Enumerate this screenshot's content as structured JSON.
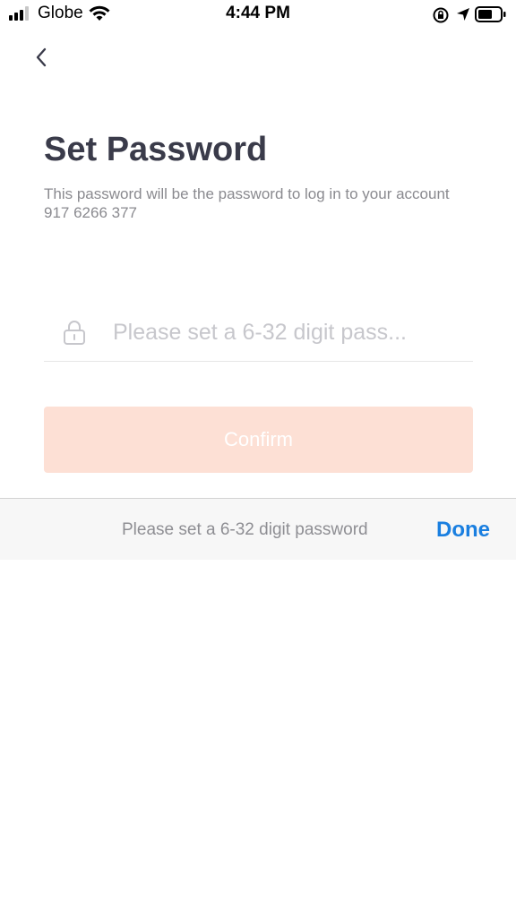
{
  "status_bar": {
    "carrier": "Globe",
    "time": "4:44 PM"
  },
  "screen": {
    "title": "Set Password",
    "subtitle": "This password will be the password to log in to your account 917 6266 377"
  },
  "password_field": {
    "placeholder": "Please set a 6-32 digit pass...",
    "value": "",
    "icon": "lock-icon"
  },
  "confirm_button": {
    "label": "Confirm",
    "enabled": false
  },
  "keyboard_accessory": {
    "hint": "Please set a 6-32 digit password",
    "done_label": "Done"
  },
  "colors": {
    "title": "#3a3b4a",
    "subtitle": "#8a8a8f",
    "confirm_disabled_bg": "#fde0d5",
    "done": "#1a7fe0"
  }
}
